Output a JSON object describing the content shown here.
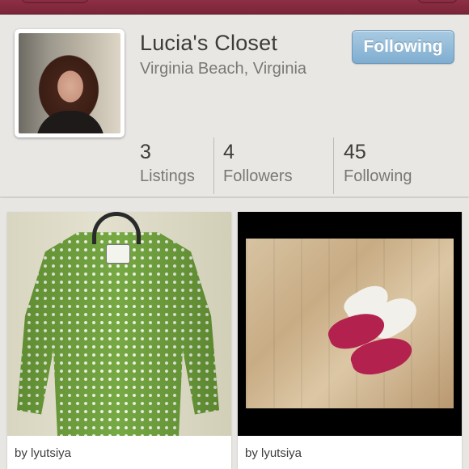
{
  "profile": {
    "name": "Lucia's Closet",
    "location": "Virginia Beach, Virginia",
    "follow_button_label": "Following"
  },
  "stats": [
    {
      "value": "3",
      "label": "Listings"
    },
    {
      "value": "4",
      "label": "Followers"
    },
    {
      "value": "45",
      "label": "Following"
    }
  ],
  "listings": [
    {
      "byline": "by lyutsiya",
      "image": "green-polka-dot-jacket"
    },
    {
      "byline": "by lyutsiya",
      "image": "pink-heeled-sandals"
    }
  ],
  "colors": {
    "topbar": "#8e2f44",
    "follow_button": "#8fb8d8",
    "background": "#e8e6e3"
  }
}
